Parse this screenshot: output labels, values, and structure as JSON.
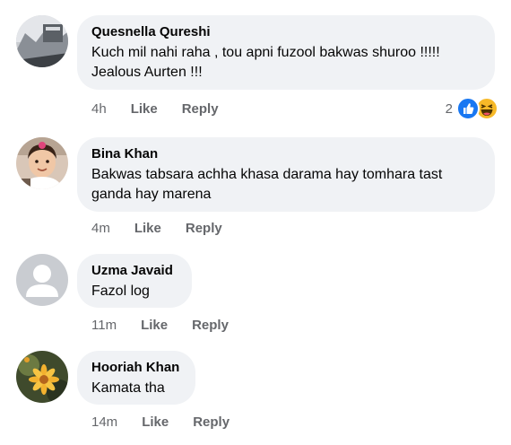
{
  "comments": [
    {
      "name": "Quesnella Qureshi",
      "text": "Kuch mil nahi raha , tou apni fuzool bakwas shuroo !!!!!\nJealous Aurten !!!",
      "time": "4h",
      "like_label": "Like",
      "reply_label": "Reply",
      "reaction_count": "2",
      "reaction_icons": [
        "like-icon",
        "haha-icon"
      ]
    },
    {
      "name": "Bina Khan",
      "text": "Bakwas tabsara achha khasa darama hay tomhara tast\nganda hay marena",
      "time": "4m",
      "like_label": "Like",
      "reply_label": "Reply"
    },
    {
      "name": "Uzma Javaid",
      "text": "Fazol log",
      "time": "11m",
      "like_label": "Like",
      "reply_label": "Reply"
    },
    {
      "name": "Hooriah Khan",
      "text": "Kamata tha",
      "time": "14m",
      "like_label": "Like",
      "reply_label": "Reply"
    }
  ],
  "colors": {
    "bubble": "#f0f2f5",
    "meta_text": "#65676b",
    "like_blue": "#1877f2",
    "haha_yellow": "#f7b928"
  }
}
